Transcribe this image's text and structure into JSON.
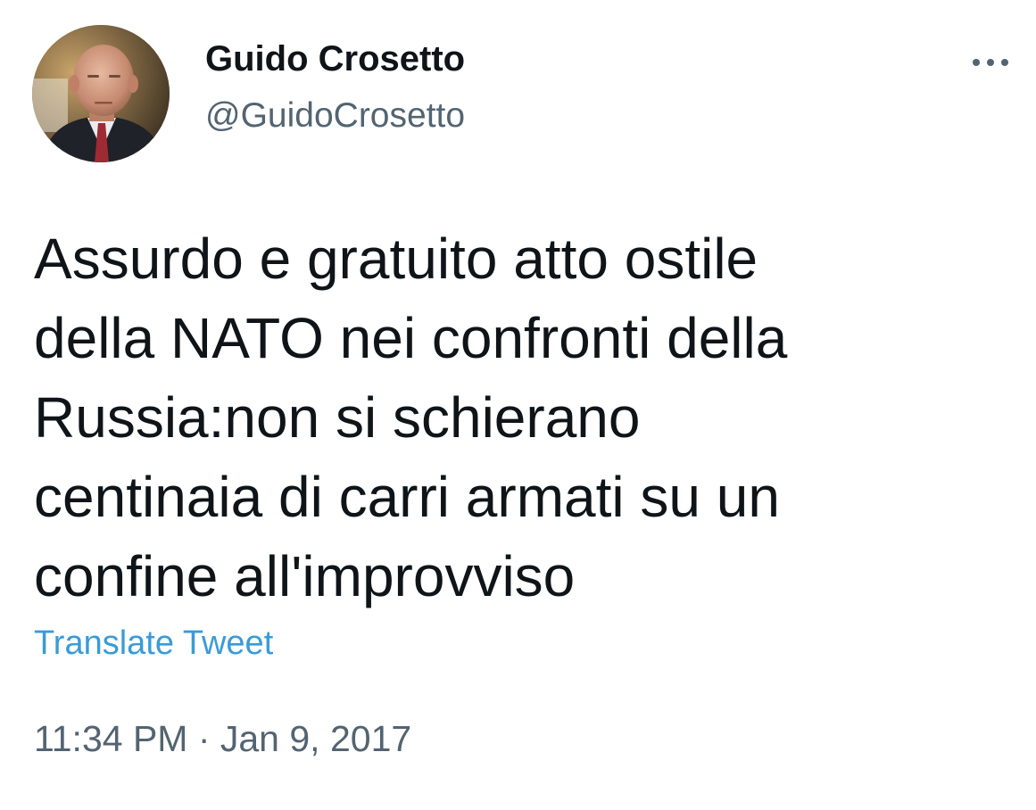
{
  "tweet": {
    "author": {
      "display_name": "Guido Crosetto",
      "handle": "@GuidoCrosetto",
      "avatar_icon": "profile-photo"
    },
    "more_icon": "more-options-icon",
    "text": "Assurdo e gratuito atto ostile\ndella NATO nei confronti della\nRussia:non si schierano\ncentinaia di carri armati su un\nconfine all'improvviso",
    "translate_label": "Translate Tweet",
    "timestamp": "11:34 PM · Jan 9, 2017"
  },
  "colors": {
    "text_primary": "#0f1419",
    "text_secondary": "#536471",
    "link": "#3a9bd8",
    "background": "#ffffff"
  }
}
